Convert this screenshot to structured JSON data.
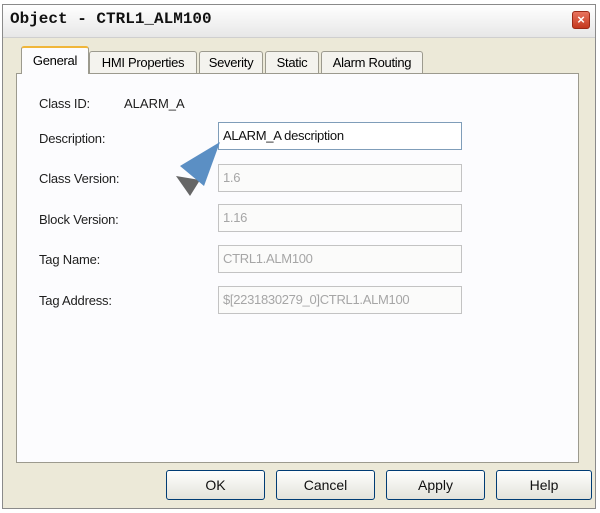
{
  "window": {
    "title": "Object - CTRL1_ALM100",
    "close_label": "×"
  },
  "tabs": [
    {
      "label": "General",
      "active": true
    },
    {
      "label": "HMI Properties"
    },
    {
      "label": "Severity"
    },
    {
      "label": "Static"
    },
    {
      "label": "Alarm Routing"
    }
  ],
  "general": {
    "class_id_label": "Class ID:",
    "class_id_value": "ALARM_A",
    "description_label": "Description:",
    "description_value": "ALARM_A description",
    "class_version_label": "Class Version:",
    "class_version_value": "1.6",
    "block_version_label": "Block Version:",
    "block_version_value": "1.16",
    "tag_name_label": "Tag Name:",
    "tag_name_value": "CTRL1.ALM100",
    "tag_address_label": "Tag Address:",
    "tag_address_value": "$[22318302​79_0]CTRL1.ALM100"
  },
  "buttons": {
    "ok": "OK",
    "cancel": "Cancel",
    "apply": "Apply",
    "help": "Help"
  },
  "colors": {
    "accent_arrow": "#5b8fc4",
    "active_tab_highlight": "#f0b63a",
    "dialog_bg": "#ece9d8"
  }
}
